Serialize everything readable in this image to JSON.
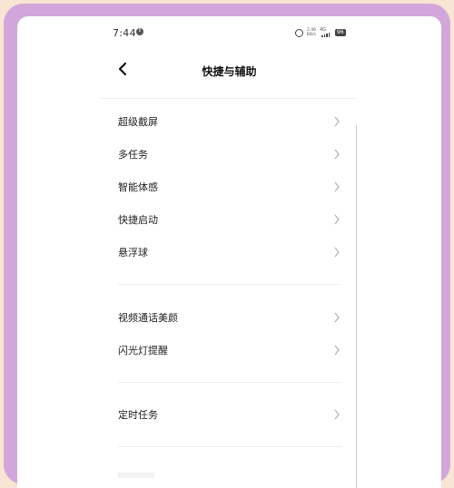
{
  "status_bar": {
    "time": "7:44",
    "speed_value": "2.46",
    "speed_unit": "KB/s",
    "network": "4G",
    "battery": "96"
  },
  "header": {
    "title": "快捷与辅助"
  },
  "sections": [
    {
      "items": [
        {
          "label": "超级截屏"
        },
        {
          "label": "多任务"
        },
        {
          "label": "智能体感"
        },
        {
          "label": "快捷启动"
        },
        {
          "label": "悬浮球"
        }
      ]
    },
    {
      "items": [
        {
          "label": "视频通话美颜"
        },
        {
          "label": "闪光灯提醒"
        }
      ]
    },
    {
      "items": [
        {
          "label": "定时任务"
        }
      ]
    }
  ],
  "colors": {
    "frame": "#d2a6da",
    "background": "#f8e5d3",
    "screen": "#ffffff"
  },
  "icons": {
    "back": "chevron-left-icon",
    "row": "chevron-right-icon"
  }
}
